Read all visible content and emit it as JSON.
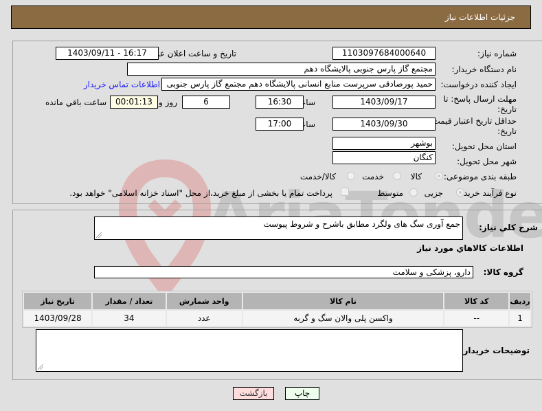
{
  "header": {
    "title": "جزئیات اطلاعات نیاز"
  },
  "form": {
    "need_number": {
      "label": "شماره نیاز:",
      "value": "1103097684000640"
    },
    "announce_datetime": {
      "label": "تاریخ و ساعت اعلان عمومی:",
      "value": "1403/09/11 - 16:17"
    },
    "buyer_org": {
      "label": "نام دستگاه خریدار:",
      "value": "مجتمع گاز پارس جنوبی  پالایشگاه دهم"
    },
    "requester": {
      "label": "ایجاد کننده درخواست:",
      "value": "حمید پورصادقی سرپرست منابع انسانی پالایشگاه دهم  مجتمع گاز پارس جنوبی",
      "contact_link": "اطلاعات تماس خریدار"
    },
    "reply_deadline": {
      "label_line1": "مهلت ارسال پاسخ: تا",
      "label_line2": "تاریخ:",
      "date": "1403/09/17",
      "time_label": "ساعت",
      "time": "16:30",
      "days": "6",
      "days_label": "روز و",
      "remaining": "00:01:13",
      "remaining_label": "ساعت باقي مانده"
    },
    "price_validity": {
      "label_line1": "حداقل تاریخ اعتبار قیمت: تا",
      "label_line2": "تاریخ:",
      "date": "1403/09/30",
      "time_label": "ساعت",
      "time": "17:00"
    },
    "province": {
      "label": "استان محل تحویل:",
      "value": "بوشهر"
    },
    "city": {
      "label": "شهر محل تحویل:",
      "value": "کنگان"
    },
    "category": {
      "label": "طبقه بندی موضوعی:",
      "options": [
        "کالا",
        "خدمت",
        "کالا/خدمت"
      ],
      "selected": "کالا"
    },
    "process_type": {
      "label": "نوع فرآیند خرید :",
      "options": [
        "جزیی",
        "متوسط"
      ],
      "selected": "جزیی",
      "payment_note": "پرداخت تمام یا بخشی از مبلغ خرید،از محل \"اسناد خزانه اسلامی\" خواهد بود."
    }
  },
  "details": {
    "description_label": "شرح کلي نياز:",
    "description_value": "جمع آوری سگ های ولگرد مطابق باشرح و شروط پیوست",
    "goods_info_title": "اطلاعات کالاهاي مورد نياز",
    "goods_group_label": "گروه کالا:",
    "goods_group_value": "دارو، پزشکی و سلامت",
    "table": {
      "columns": [
        "ردیف",
        "کد کالا",
        "نام کالا",
        "واحد شمارش",
        "تعداد / مقدار",
        "تاریخ نیاز"
      ],
      "rows": [
        [
          "1",
          "--",
          "واکسن پلی والان سگ و گربه",
          "عدد",
          "34",
          "1403/09/28"
        ]
      ]
    },
    "buyer_notes_label": "توضیحات خریدار:",
    "buyer_notes_value": ""
  },
  "buttons": {
    "print": "چاپ",
    "back": "بازگشت"
  },
  "watermark": {
    "text": "AriaTender.net"
  },
  "colors": {
    "header_bg": "#8b6b41",
    "link": "#1a1aff",
    "print_bg": "#eeffee",
    "back_bg": "#ffdddd"
  }
}
